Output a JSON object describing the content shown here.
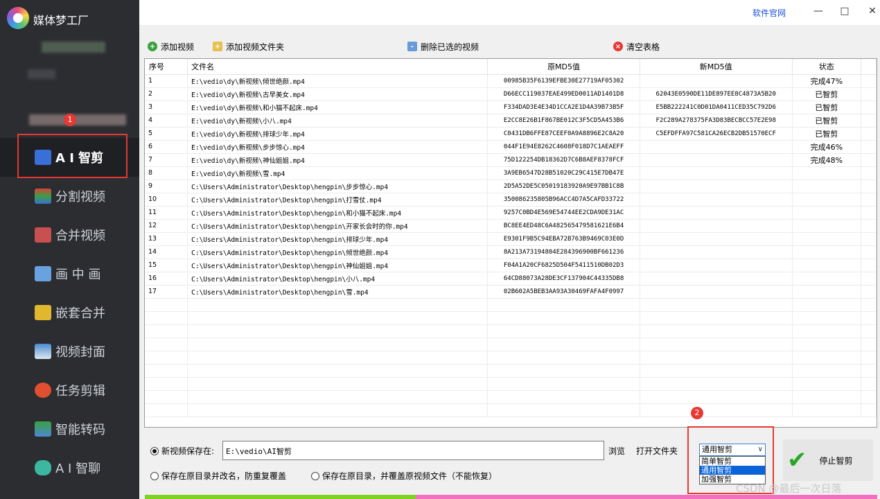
{
  "app": {
    "title": "媒体梦工厂",
    "site_link": "软件官网"
  },
  "window_controls": {
    "minimize": "—",
    "maximize": "□",
    "close": "✕"
  },
  "sidebar": {
    "badge": "1",
    "items": [
      {
        "label": "A I 智剪",
        "icon": "ai-cut-icon",
        "color": "#3a6fd8"
      },
      {
        "label": "分割视频",
        "icon": "split-video-icon",
        "color": "#d94040"
      },
      {
        "label": "合并视频",
        "icon": "merge-video-icon",
        "color": "#c85050"
      },
      {
        "label": "画 中 画",
        "icon": "picture-in-picture-icon",
        "color": "#6aa2e0"
      },
      {
        "label": "嵌套合并",
        "icon": "nest-merge-icon",
        "color": "#e0b830"
      },
      {
        "label": "视频封面",
        "icon": "video-cover-icon",
        "color": "#4a8ad0"
      },
      {
        "label": "任务剪辑",
        "icon": "task-edit-icon",
        "color": "#e05030"
      },
      {
        "label": "智能转码",
        "icon": "transcode-icon",
        "color": "#3aa040"
      },
      {
        "label": "A I 智聊",
        "icon": "ai-chat-icon",
        "color": "#3cb8a0"
      }
    ]
  },
  "toolbar": {
    "add_video": "添加视频",
    "add_folder": "添加视频文件夹",
    "delete_selected": "删除已选的视频",
    "clear_table": "清空表格"
  },
  "table": {
    "headers": {
      "idx": "序号",
      "file": "文件名",
      "old_md5": "原MD5值",
      "new_md5": "新MD5值",
      "status": "状态"
    },
    "rows": [
      {
        "idx": "1",
        "file": "E:\\vedio\\dy\\新视频\\倾世绝颜.mp4",
        "old_md5": "00985B35F6139EFBE30E27719AF05302",
        "new_md5": "",
        "status": "完成47%"
      },
      {
        "idx": "2",
        "file": "E:\\vedio\\dy\\新视频\\古早美女.mp4",
        "old_md5": "D66ECC119037EAE499ED0011AD1401D8",
        "new_md5": "62043E0590DE11DE897EE8C4873A5B20",
        "status": "已智剪"
      },
      {
        "idx": "3",
        "file": "E:\\vedio\\dy\\新视频\\和小猫不起床.mp4",
        "old_md5": "F334DAD3E4E34D1CCA2E1D4A39B73B5F",
        "new_md5": "E5BB222241C0D01DA0411CED35C792D6",
        "status": "已智剪"
      },
      {
        "idx": "4",
        "file": "E:\\vedio\\dy\\新视频\\小八.mp4",
        "old_md5": "E2CC8E26B1F867BE012C3F5CD5A453B6",
        "new_md5": "F2C289A278375FA3D83BECBCC57E2E98",
        "status": "已智剪"
      },
      {
        "idx": "5",
        "file": "E:\\vedio\\dy\\新视频\\排球少年.mp4",
        "old_md5": "C0431DB6FFE87CEEF0A9A8896E2C8A20",
        "new_md5": "C5EFDFFA97C581CA26ECB2DB51570ECF",
        "status": "已智剪"
      },
      {
        "idx": "6",
        "file": "E:\\vedio\\dy\\新视频\\步步惊心.mp4",
        "old_md5": "044F1E94E8262C4608F018D7C1AEAEFF",
        "new_md5": "",
        "status": "完成46%"
      },
      {
        "idx": "7",
        "file": "E:\\vedio\\dy\\新视频\\神仙姐姐.mp4",
        "old_md5": "75D122254DB18362D7C6B8AEF8378FCF",
        "new_md5": "",
        "status": "完成48%"
      },
      {
        "idx": "8",
        "file": "E:\\vedio\\dy\\新视频\\雪.mp4",
        "old_md5": "3A9EB6547D28B51020C29C415E7DB47E",
        "new_md5": "",
        "status": ""
      },
      {
        "idx": "9",
        "file": "C:\\Users\\Administrator\\Desktop\\hengpin\\步步惊心.mp4",
        "old_md5": "2D5A52DE5C05019183920A9E97BB1C8B",
        "new_md5": "",
        "status": ""
      },
      {
        "idx": "10",
        "file": "C:\\Users\\Administrator\\Desktop\\hengpin\\打雪仗.mp4",
        "old_md5": "350086235805B96ACC4D7A5CAFD33722",
        "new_md5": "",
        "status": ""
      },
      {
        "idx": "11",
        "file": "C:\\Users\\Administrator\\Desktop\\hengpin\\和小猫不起床.mp4",
        "old_md5": "9257C0BD4E569E54744EE2CDA9DE31AC",
        "new_md5": "",
        "status": ""
      },
      {
        "idx": "12",
        "file": "C:\\Users\\Administrator\\Desktop\\hengpin\\开家长会时的你.mp4",
        "old_md5": "BC8EE4ED48C6A482565479581621E6B4",
        "new_md5": "",
        "status": ""
      },
      {
        "idx": "13",
        "file": "C:\\Users\\Administrator\\Desktop\\hengpin\\排球少年.mp4",
        "old_md5": "E9301F9B5C94EBA72B763B9469C03E0D",
        "new_md5": "",
        "status": ""
      },
      {
        "idx": "14",
        "file": "C:\\Users\\Administrator\\Desktop\\hengpin\\倾世绝颜.mp4",
        "old_md5": "8A213A73194804E284396900BF661236",
        "new_md5": "",
        "status": ""
      },
      {
        "idx": "15",
        "file": "C:\\Users\\Administrator\\Desktop\\hengpin\\神仙姐姐.mp4",
        "old_md5": "F04A1A20CF6825D504F5411510DB02D3",
        "new_md5": "",
        "status": ""
      },
      {
        "idx": "16",
        "file": "C:\\Users\\Administrator\\Desktop\\hengpin\\小八.mp4",
        "old_md5": "64CD88073A28DE3CF137904C44335DB8",
        "new_md5": "",
        "status": ""
      },
      {
        "idx": "17",
        "file": "C:\\Users\\Administrator\\Desktop\\hengpin\\雪.mp4",
        "old_md5": "02B602A5BEB3AA93A30469FAFA4F0997",
        "new_md5": "",
        "status": ""
      }
    ]
  },
  "output": {
    "save_new_label": "新视频保存在:",
    "save_path": "E:\\vedio\\AI智剪",
    "browse": "浏览",
    "open_folder": "打开文件夹",
    "save_rename_label": "保存在原目录并改名，防重复覆盖",
    "save_overwrite_label": "保存在原目录，并覆盖原视频文件（不能恢复）"
  },
  "mode": {
    "badge": "2",
    "selected": "通用智剪",
    "options": [
      "简单智剪",
      "通用智剪",
      "加强智剪"
    ],
    "highlighted": "通用智剪"
  },
  "stop_button": {
    "label": "停止智剪"
  },
  "progress": {
    "value": 0.37,
    "fill_color": "#7ed321",
    "rest_color": "#f36fbf"
  },
  "watermark": "CSDN @最后一次日落"
}
